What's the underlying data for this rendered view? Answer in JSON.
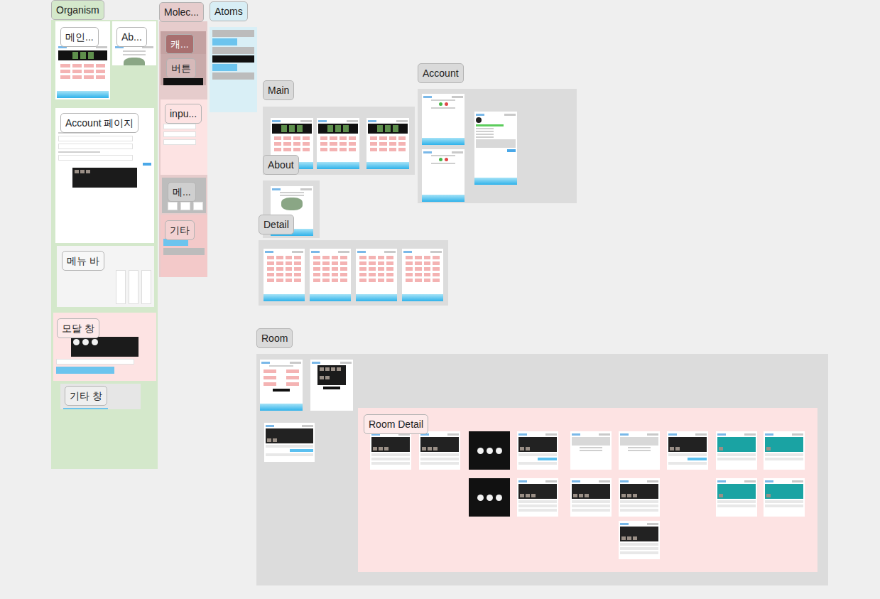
{
  "groups": [
    {
      "label": "Organism",
      "color": "#d4e8cb",
      "items": [
        {
          "label": "메인...",
          "kind": "main",
          "color": "#ffffff"
        },
        {
          "label": "Ab...",
          "kind": "about",
          "color": "#ffffff"
        },
        {
          "label": "Account 페이지",
          "kind": "account",
          "color": "#ffffff"
        },
        {
          "label": "메뉴 바",
          "kind": "menu",
          "color": "#f4f4f4"
        },
        {
          "label": "모달 창",
          "kind": "modal",
          "color": "#fde3e3"
        },
        {
          "label": "기타 창",
          "kind": "misc",
          "color": "#e6e6e6"
        }
      ],
      "screens": []
    },
    {
      "label": "Molec...",
      "color": "#e6cccc",
      "items": [
        {
          "label": "캐...",
          "kind": "char",
          "color": "#c4a2a2"
        },
        {
          "label": "버튼",
          "kind": "button",
          "color": "#c9aaaa"
        },
        {
          "label": "inpu...",
          "kind": "input",
          "color": "#fde3e3"
        },
        {
          "label": "메...",
          "kind": "menu",
          "color": "#bdbdbd"
        },
        {
          "label": "기타",
          "kind": "misc",
          "color": "#f3c9c9"
        }
      ],
      "screens": []
    },
    {
      "label": "Atoms",
      "color": "#d9eff6",
      "items": [],
      "screens": [
        {
          "kind": "atoms"
        }
      ]
    },
    {
      "label": "Main",
      "color": "#dcdcdc",
      "items": [],
      "screens": [
        {
          "kind": "main"
        },
        {
          "kind": "main"
        },
        {
          "kind": "main"
        }
      ]
    },
    {
      "label": "About",
      "color": "#dcdcdc",
      "items": [],
      "screens": [
        {
          "kind": "about"
        }
      ]
    },
    {
      "label": "Detail",
      "color": "#dcdcdc",
      "items": [],
      "screens": [
        {
          "kind": "list"
        },
        {
          "kind": "list"
        },
        {
          "kind": "list"
        },
        {
          "kind": "list"
        }
      ]
    },
    {
      "label": "Account",
      "color": "#dcdcdc",
      "items": [],
      "screens": [
        {
          "kind": "login"
        },
        {
          "kind": "login"
        },
        {
          "kind": "profile"
        }
      ]
    },
    {
      "label": "Room",
      "color": "#dcdcdc",
      "items": [],
      "screens": [
        {
          "kind": "form"
        },
        {
          "kind": "call"
        },
        {
          "kind": "roomlist"
        }
      ]
    },
    {
      "label": "Room Detail",
      "color": "#fde3e3",
      "items": [],
      "screens": [
        {
          "kind": "room"
        },
        {
          "kind": "room"
        },
        {
          "kind": "dark"
        },
        {
          "kind": "roomlist"
        },
        {
          "kind": "blank"
        },
        {
          "kind": "blank"
        },
        {
          "kind": "roomlist"
        },
        {
          "kind": "photo"
        },
        {
          "kind": "photo"
        },
        {
          "kind": "dark"
        },
        {
          "kind": "room"
        },
        {
          "kind": "room"
        },
        {
          "kind": "room"
        },
        {
          "kind": "photo"
        },
        {
          "kind": "photo"
        },
        {
          "kind": "room"
        }
      ]
    }
  ]
}
